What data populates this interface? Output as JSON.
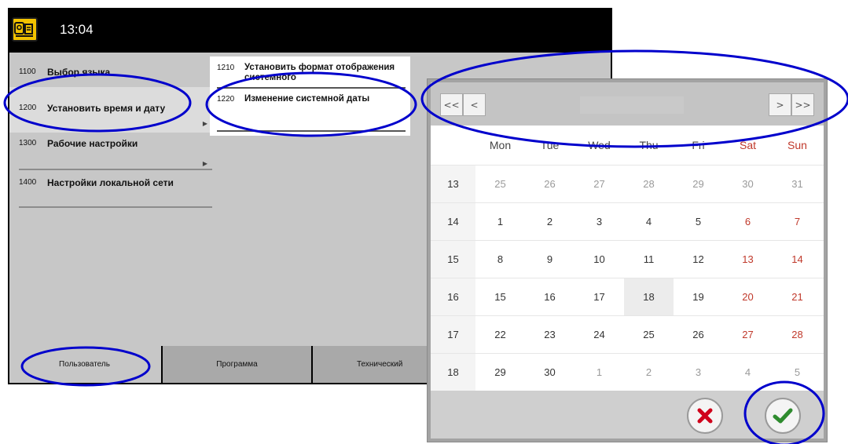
{
  "topbar": {
    "time": "13:04",
    "app_icon": "tooth-scanner-icon"
  },
  "menu": {
    "items": [
      {
        "code": "1100",
        "label": "Выбор языка"
      },
      {
        "code": "1200",
        "label": "Установить время и дату"
      },
      {
        "code": "1300",
        "label": "Рабочие настройки"
      },
      {
        "code": "1400",
        "label": "Настройки локальной сети"
      }
    ]
  },
  "submenu": {
    "items": [
      {
        "code": "1210",
        "label": "Установить формат отображения системного"
      },
      {
        "code": "1220",
        "label": "Изменение системной даты"
      }
    ]
  },
  "tabs": [
    "Пользователь",
    "Программа",
    "Технический"
  ],
  "calendar": {
    "nav": {
      "first": "<<",
      "prev": "<",
      "next": ">",
      "last": ">>"
    },
    "month_title": "",
    "weekdays": [
      "Mon",
      "Tue",
      "Wed",
      "Thu",
      "Fri",
      "Sat",
      "Sun"
    ],
    "weeks": [
      {
        "week": "13",
        "days": [
          "25",
          "26",
          "27",
          "28",
          "29",
          "30",
          "31"
        ]
      },
      {
        "week": "14",
        "days": [
          "1",
          "2",
          "3",
          "4",
          "5",
          "6",
          "7"
        ]
      },
      {
        "week": "15",
        "days": [
          "8",
          "9",
          "10",
          "11",
          "12",
          "13",
          "14"
        ]
      },
      {
        "week": "16",
        "days": [
          "15",
          "16",
          "17",
          "18",
          "19",
          "20",
          "21"
        ]
      },
      {
        "week": "17",
        "days": [
          "22",
          "23",
          "24",
          "25",
          "26",
          "27",
          "28"
        ]
      },
      {
        "week": "18",
        "days": [
          "29",
          "30",
          "1",
          "2",
          "3",
          "4",
          "5"
        ]
      }
    ],
    "cancel_icon": "close-icon",
    "confirm_icon": "checkmark-icon"
  },
  "colors": {
    "weekend": "#c0392b",
    "cancel": "#d0021b",
    "confirm": "#2e8b2e",
    "annotation": "#0000cc"
  }
}
